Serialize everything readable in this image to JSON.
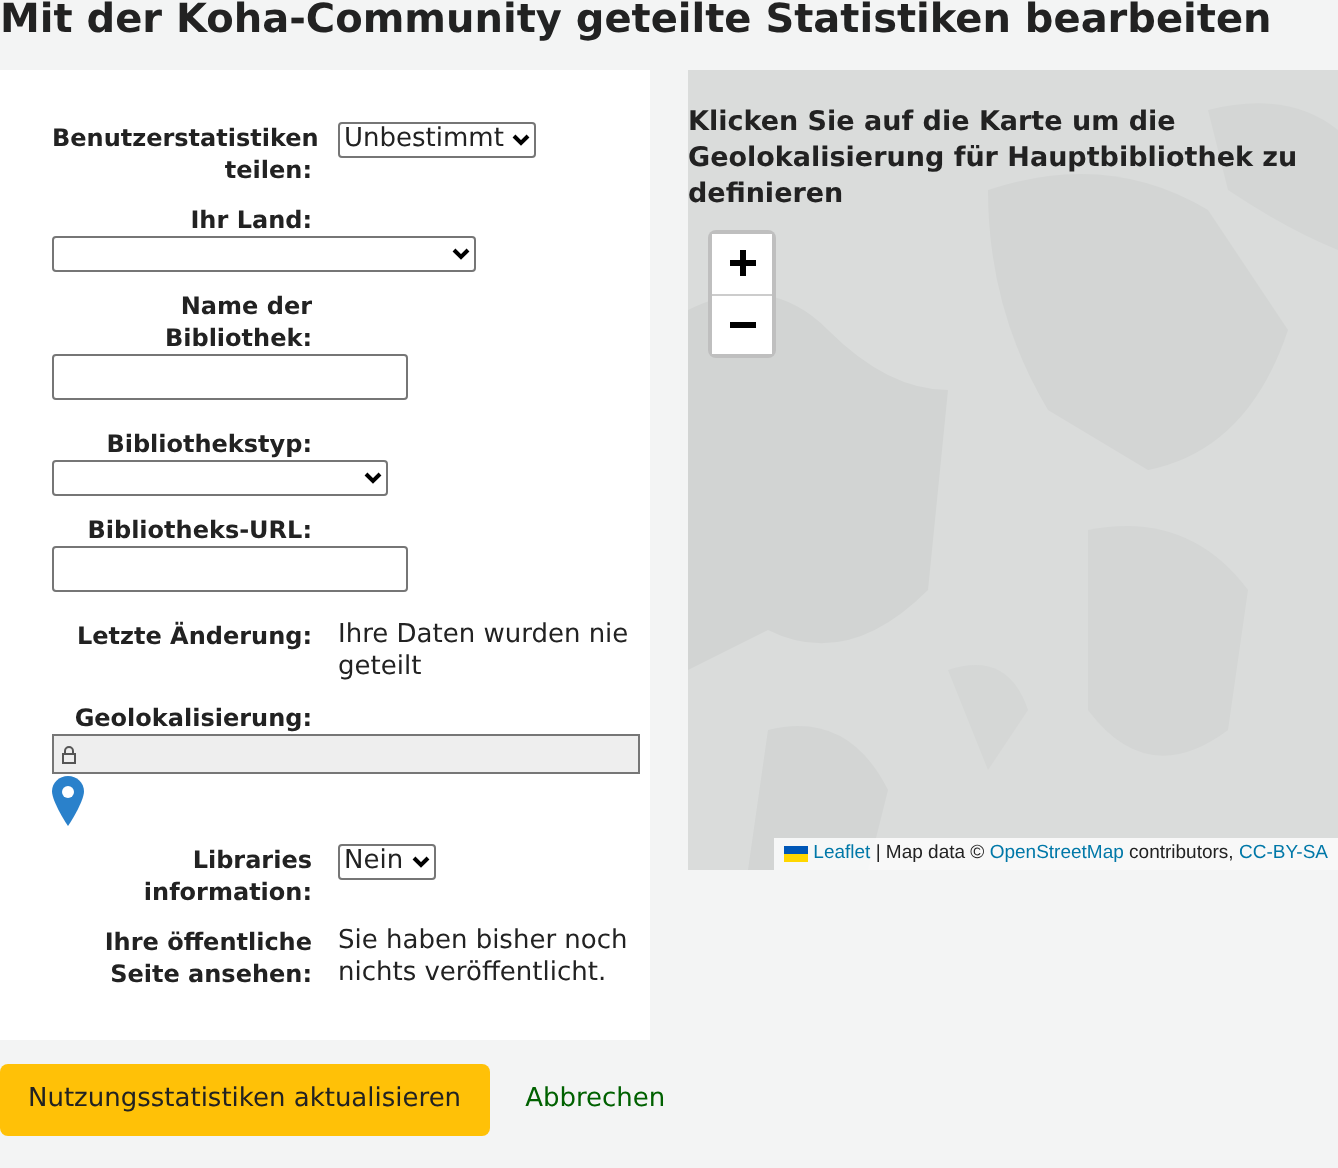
{
  "heading": "Mit der Koha-Community geteilte Statistiken bearbeiten",
  "fields": [
    {
      "kind": "select",
      "label": "Benutzerstatistiken teilen:",
      "value": "Unbestimmt"
    },
    {
      "kind": "wide-select",
      "label": "Ihr Land:"
    },
    {
      "kind": "text",
      "label": "Name der Bibliothek:"
    },
    {
      "kind": "select",
      "label": "Bibliothekstyp:"
    },
    {
      "kind": "text",
      "label": "Bibliotheks-URL:"
    },
    {
      "kind": "static",
      "label": "Letzte Änderung:",
      "value": "Ihre Daten wurden nie geteilt"
    },
    {
      "kind": "geo",
      "label": "Geolokalisierung:"
    },
    {
      "kind": "select",
      "label": "Libraries information:",
      "value": "Nein"
    },
    {
      "kind": "static",
      "label": "Ihre öffentliche Seite ansehen:",
      "value": "Sie haben bisher noch nichts veröffentlicht."
    }
  ],
  "map": {
    "instruction": "Klicken Sie auf die Karte um die Geolokalisierung für Hauptbibliothek zu definieren",
    "attribution": {
      "leaflet": "Leaflet",
      "text1": " | Map data © ",
      "osm": "OpenStreetMap",
      "text2": " contributors, ",
      "license": "CC-BY-SA"
    }
  },
  "buttons": {
    "submit": "Nutzungsstatistiken aktualisieren",
    "cancel": "Abbrechen"
  }
}
